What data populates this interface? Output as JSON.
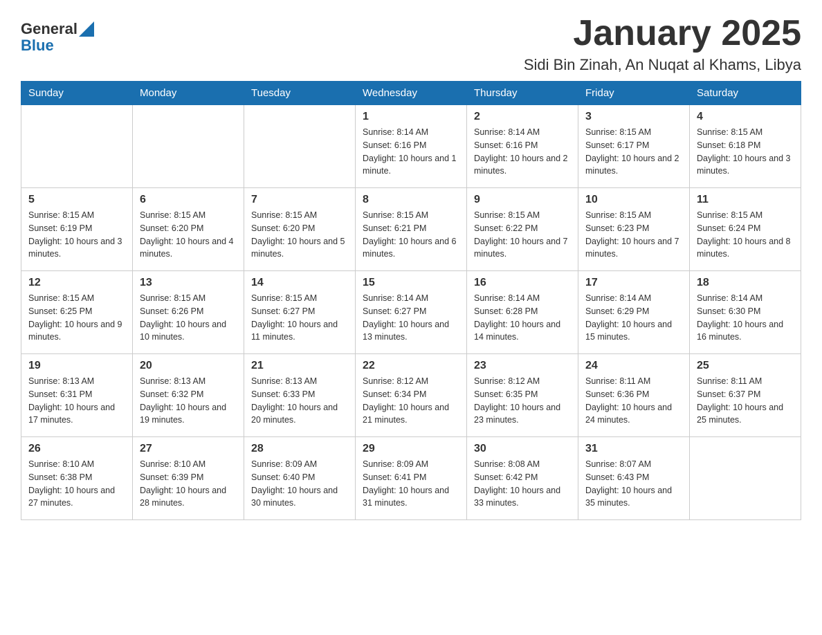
{
  "header": {
    "logo_general": "General",
    "logo_blue": "Blue",
    "month_title": "January 2025",
    "location": "Sidi Bin Zinah, An Nuqat al Khams, Libya"
  },
  "weekdays": [
    "Sunday",
    "Monday",
    "Tuesday",
    "Wednesday",
    "Thursday",
    "Friday",
    "Saturday"
  ],
  "weeks": [
    [
      {
        "day": "",
        "info": ""
      },
      {
        "day": "",
        "info": ""
      },
      {
        "day": "",
        "info": ""
      },
      {
        "day": "1",
        "info": "Sunrise: 8:14 AM\nSunset: 6:16 PM\nDaylight: 10 hours and 1 minute."
      },
      {
        "day": "2",
        "info": "Sunrise: 8:14 AM\nSunset: 6:16 PM\nDaylight: 10 hours and 2 minutes."
      },
      {
        "day": "3",
        "info": "Sunrise: 8:15 AM\nSunset: 6:17 PM\nDaylight: 10 hours and 2 minutes."
      },
      {
        "day": "4",
        "info": "Sunrise: 8:15 AM\nSunset: 6:18 PM\nDaylight: 10 hours and 3 minutes."
      }
    ],
    [
      {
        "day": "5",
        "info": "Sunrise: 8:15 AM\nSunset: 6:19 PM\nDaylight: 10 hours and 3 minutes."
      },
      {
        "day": "6",
        "info": "Sunrise: 8:15 AM\nSunset: 6:20 PM\nDaylight: 10 hours and 4 minutes."
      },
      {
        "day": "7",
        "info": "Sunrise: 8:15 AM\nSunset: 6:20 PM\nDaylight: 10 hours and 5 minutes."
      },
      {
        "day": "8",
        "info": "Sunrise: 8:15 AM\nSunset: 6:21 PM\nDaylight: 10 hours and 6 minutes."
      },
      {
        "day": "9",
        "info": "Sunrise: 8:15 AM\nSunset: 6:22 PM\nDaylight: 10 hours and 7 minutes."
      },
      {
        "day": "10",
        "info": "Sunrise: 8:15 AM\nSunset: 6:23 PM\nDaylight: 10 hours and 7 minutes."
      },
      {
        "day": "11",
        "info": "Sunrise: 8:15 AM\nSunset: 6:24 PM\nDaylight: 10 hours and 8 minutes."
      }
    ],
    [
      {
        "day": "12",
        "info": "Sunrise: 8:15 AM\nSunset: 6:25 PM\nDaylight: 10 hours and 9 minutes."
      },
      {
        "day": "13",
        "info": "Sunrise: 8:15 AM\nSunset: 6:26 PM\nDaylight: 10 hours and 10 minutes."
      },
      {
        "day": "14",
        "info": "Sunrise: 8:15 AM\nSunset: 6:27 PM\nDaylight: 10 hours and 11 minutes."
      },
      {
        "day": "15",
        "info": "Sunrise: 8:14 AM\nSunset: 6:27 PM\nDaylight: 10 hours and 13 minutes."
      },
      {
        "day": "16",
        "info": "Sunrise: 8:14 AM\nSunset: 6:28 PM\nDaylight: 10 hours and 14 minutes."
      },
      {
        "day": "17",
        "info": "Sunrise: 8:14 AM\nSunset: 6:29 PM\nDaylight: 10 hours and 15 minutes."
      },
      {
        "day": "18",
        "info": "Sunrise: 8:14 AM\nSunset: 6:30 PM\nDaylight: 10 hours and 16 minutes."
      }
    ],
    [
      {
        "day": "19",
        "info": "Sunrise: 8:13 AM\nSunset: 6:31 PM\nDaylight: 10 hours and 17 minutes."
      },
      {
        "day": "20",
        "info": "Sunrise: 8:13 AM\nSunset: 6:32 PM\nDaylight: 10 hours and 19 minutes."
      },
      {
        "day": "21",
        "info": "Sunrise: 8:13 AM\nSunset: 6:33 PM\nDaylight: 10 hours and 20 minutes."
      },
      {
        "day": "22",
        "info": "Sunrise: 8:12 AM\nSunset: 6:34 PM\nDaylight: 10 hours and 21 minutes."
      },
      {
        "day": "23",
        "info": "Sunrise: 8:12 AM\nSunset: 6:35 PM\nDaylight: 10 hours and 23 minutes."
      },
      {
        "day": "24",
        "info": "Sunrise: 8:11 AM\nSunset: 6:36 PM\nDaylight: 10 hours and 24 minutes."
      },
      {
        "day": "25",
        "info": "Sunrise: 8:11 AM\nSunset: 6:37 PM\nDaylight: 10 hours and 25 minutes."
      }
    ],
    [
      {
        "day": "26",
        "info": "Sunrise: 8:10 AM\nSunset: 6:38 PM\nDaylight: 10 hours and 27 minutes."
      },
      {
        "day": "27",
        "info": "Sunrise: 8:10 AM\nSunset: 6:39 PM\nDaylight: 10 hours and 28 minutes."
      },
      {
        "day": "28",
        "info": "Sunrise: 8:09 AM\nSunset: 6:40 PM\nDaylight: 10 hours and 30 minutes."
      },
      {
        "day": "29",
        "info": "Sunrise: 8:09 AM\nSunset: 6:41 PM\nDaylight: 10 hours and 31 minutes."
      },
      {
        "day": "30",
        "info": "Sunrise: 8:08 AM\nSunset: 6:42 PM\nDaylight: 10 hours and 33 minutes."
      },
      {
        "day": "31",
        "info": "Sunrise: 8:07 AM\nSunset: 6:43 PM\nDaylight: 10 hours and 35 minutes."
      },
      {
        "day": "",
        "info": ""
      }
    ]
  ]
}
